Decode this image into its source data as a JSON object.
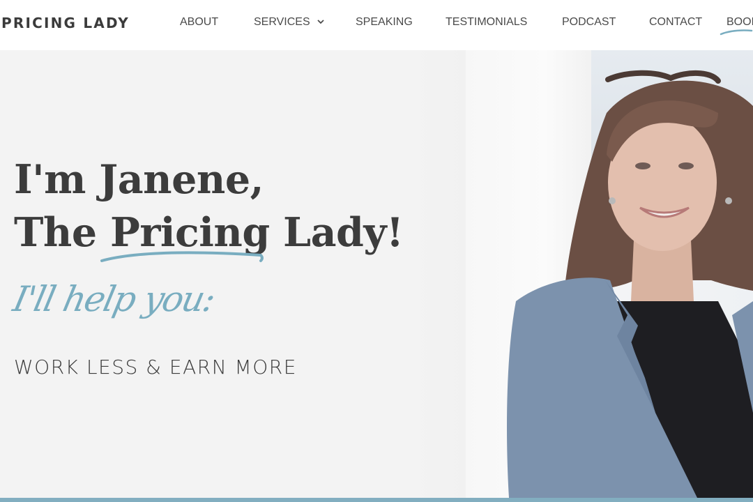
{
  "header": {
    "logo": "PRICING LADY",
    "nav": [
      {
        "label": "ABOUT"
      },
      {
        "label": "SERVICES"
      },
      {
        "label": "SPEAKING"
      },
      {
        "label": "TESTIMONIALS"
      },
      {
        "label": "PODCAST"
      },
      {
        "label": "CONTACT"
      },
      {
        "label": "BOOK"
      }
    ]
  },
  "hero": {
    "headline_line1": "I'm Janene,",
    "headline_line2": "The Pricing Lady!",
    "script_text": "I'll help you:",
    "tagline": "WORK LESS & EARN MORE"
  },
  "colors": {
    "accent": "#79adc0",
    "text": "#3c3c3c",
    "bar": "#82aec0"
  }
}
